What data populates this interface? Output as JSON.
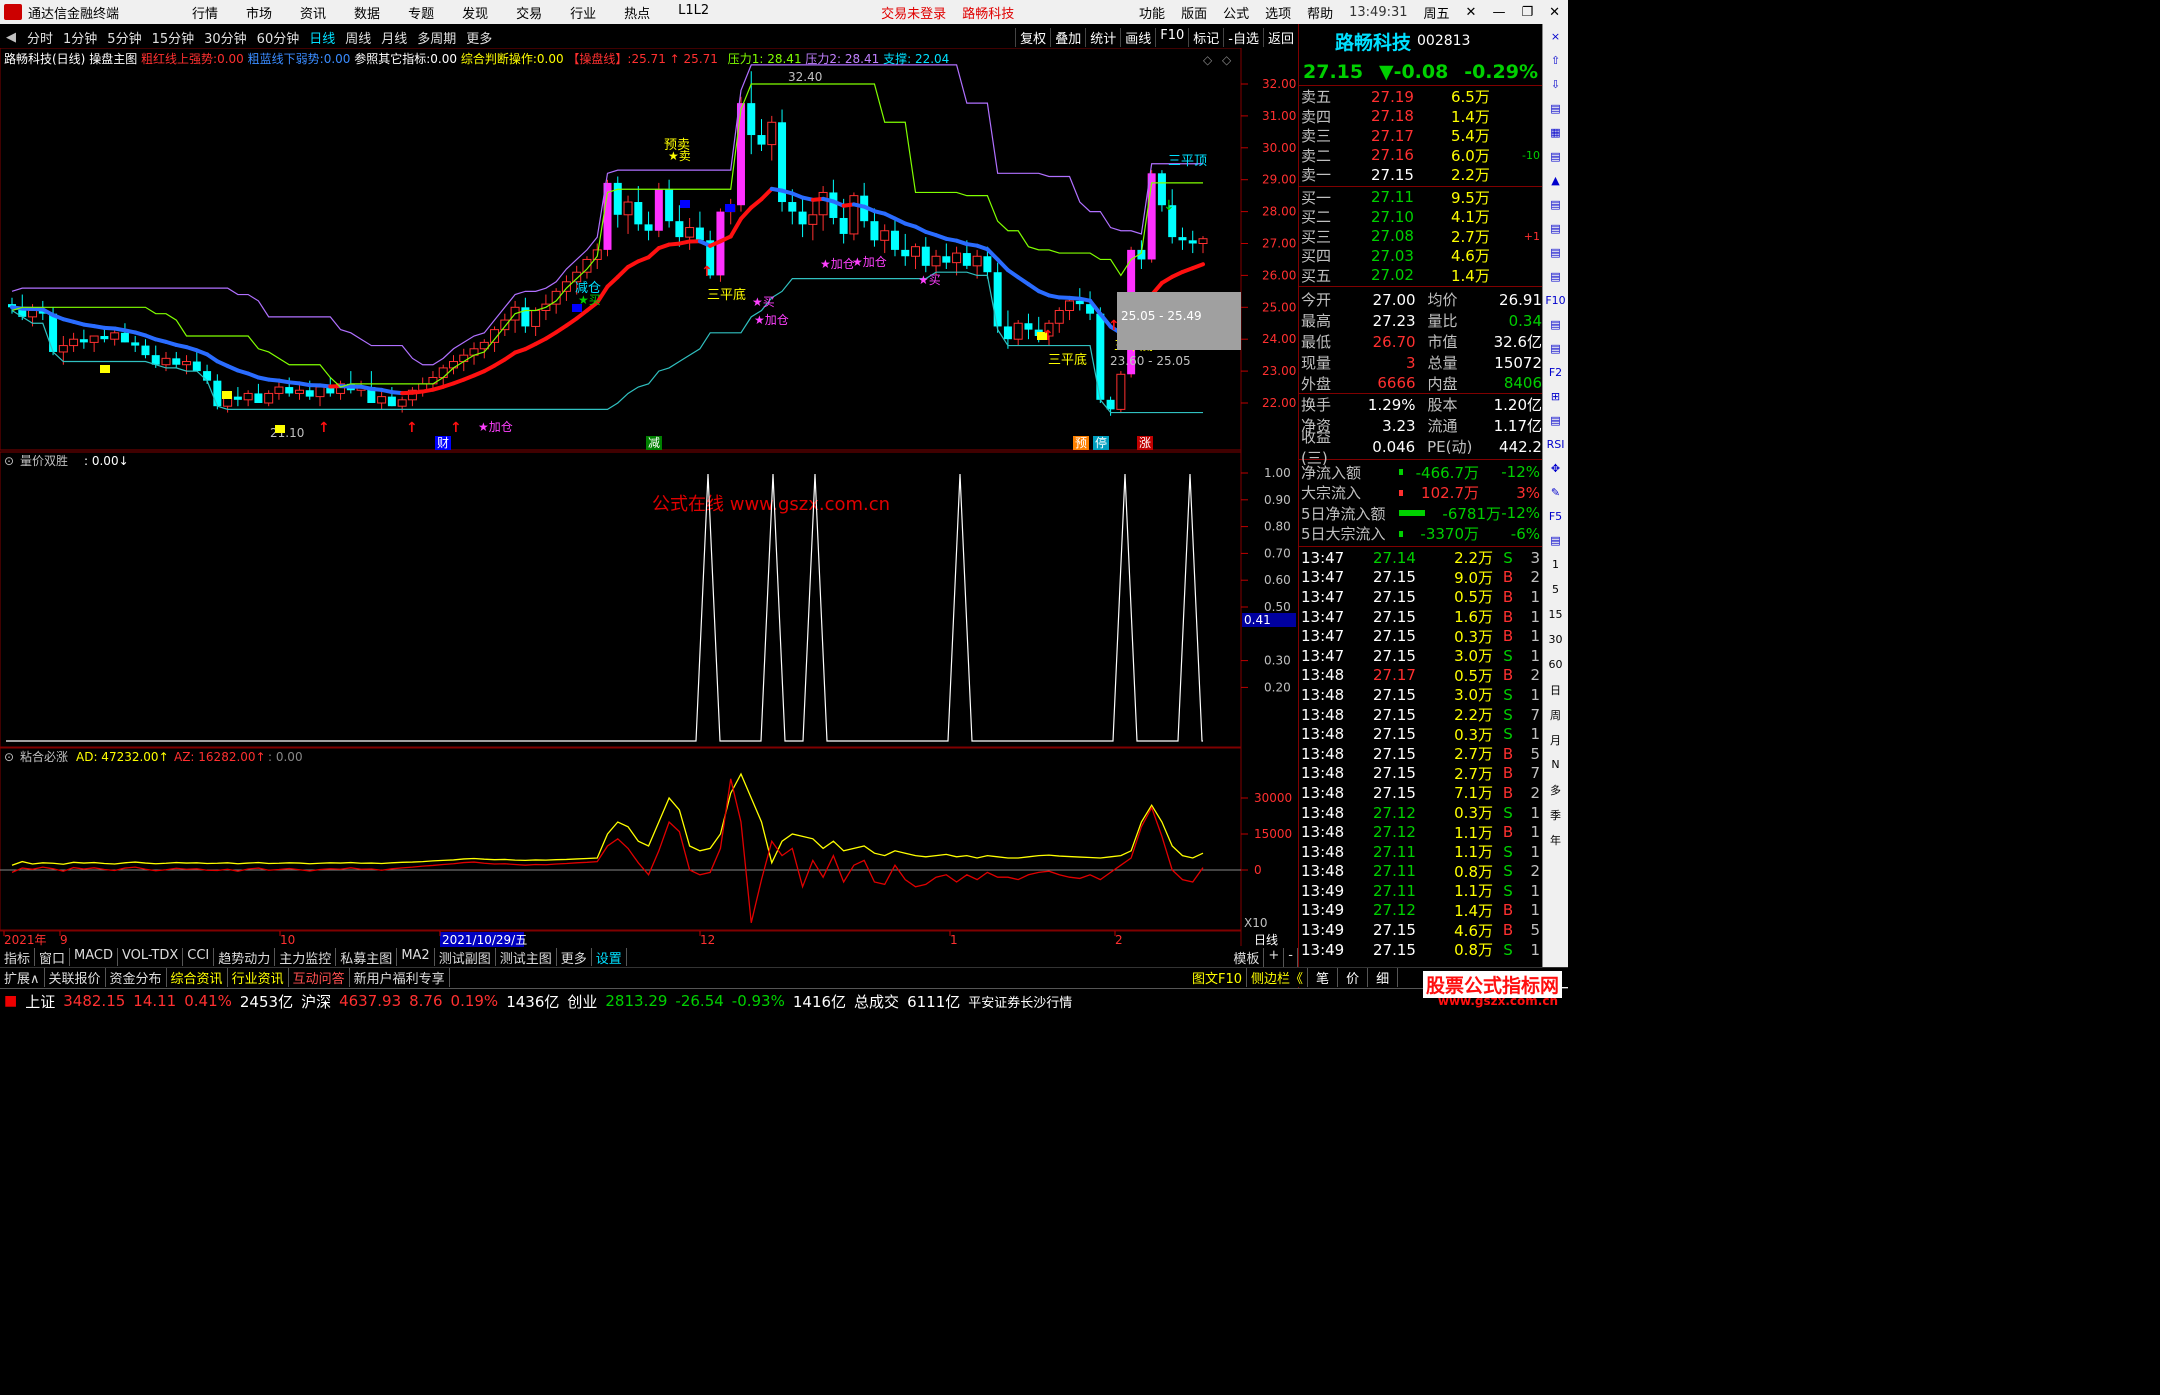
{
  "titlebar": {
    "app_title": "通达信金融终端",
    "menus": [
      "行情",
      "市场",
      "资讯",
      "数据",
      "专题",
      "发现",
      "交易",
      "行业",
      "热点",
      "L1L2"
    ],
    "login": "交易未登录",
    "stock": "路畅科技",
    "right_menus": [
      "功能",
      "版面",
      "公式",
      "选项",
      "帮助"
    ],
    "time": "13:49:31",
    "weekday": "周五"
  },
  "periods": [
    "分时",
    "1分钟",
    "5分钟",
    "15分钟",
    "30分钟",
    "60分钟",
    "日线",
    "周线",
    "月线",
    "多周期",
    "更多"
  ],
  "active_period": "日线",
  "toolbar": [
    "复权",
    "叠加",
    "统计",
    "画线",
    "F10",
    "标记",
    "-自选",
    "返回"
  ],
  "info": {
    "name": "路畅科技(日线)",
    "main": "操盘主图",
    "red_label": "粗红线上强势:",
    "red_val": "0.00",
    "blue_label": "粗蓝线下弱势:",
    "blue_val": "0.00",
    "ref_label": "参照其它指标:",
    "ref_val": "0.00",
    "judge_label": "综合判断操作:",
    "judge_val": "0.00",
    "op_label": "【操盘线】:",
    "op_val1": "25.71",
    "op_val2": "25.71",
    "p1": "压力1: 28.41",
    "p2": "压力2: 28.41",
    "sup": "支撑: 22.04"
  },
  "main_axis": [
    "32.00",
    "31.00",
    "30.00",
    "29.00",
    "28.00",
    "27.00",
    "26.00",
    "25.00",
    "24.00",
    "23.00",
    "22.00"
  ],
  "main_annotations": {
    "high": "32.40",
    "low": "21.10",
    "sell_ann": "预卖",
    "reduce": "减仓",
    "three_low": "三平底",
    "three_top": "三平顶",
    "add": "加仓",
    "buy": "买",
    "zone1": "25.05 - 25.49",
    "zone2": "23.60 - 25.05",
    "tags": [
      "财",
      "减",
      "预",
      "停",
      "涨"
    ]
  },
  "sub1": {
    "label": "量价双胜",
    "value": "0.00",
    "axis": [
      "1.00",
      "0.90",
      "0.80",
      "0.70",
      "0.60",
      "0.50",
      "0.30",
      "0.20"
    ],
    "cursor": "0.41",
    "watermark": "公式在线 www.gszx.com.cn"
  },
  "sub2": {
    "label": "粘合必涨",
    "ad_label": "AD: 47232.00",
    "az_label": "AZ: 16282.00",
    "extra": ": 0.00",
    "axis": [
      "30000",
      "15000",
      "0"
    ],
    "x10": "X10"
  },
  "xaxis": {
    "labels": [
      "2021年",
      "9",
      "10",
      "2021/10/29/五",
      "12",
      "1",
      "2"
    ],
    "unit": "日线"
  },
  "bottomtabs": [
    "指标",
    "窗口",
    "MACD",
    "VOL-TDX",
    "CCI",
    "趋势动力",
    "主力监控",
    "私募主图",
    "MA2",
    "测试副图",
    "测试主图",
    "更多",
    "设置"
  ],
  "bottomtabs_right": [
    "模板",
    "+",
    "-"
  ],
  "bottomtabs2": [
    "扩展∧",
    "关联报价",
    "资金分布",
    "综合资讯",
    "行业资讯",
    "互动问答",
    "新用户福利专享"
  ],
  "bottomtabs2_right": [
    "图文F10",
    "侧边栏《",
    "笔",
    "价",
    "细"
  ],
  "stock": {
    "name": "路畅科技",
    "code": "002813",
    "price": "27.15",
    "change": "▼-0.08",
    "pct": "-0.29%"
  },
  "asks": [
    {
      "l": "卖五",
      "p": "27.19",
      "v": "6.5万",
      "d": ""
    },
    {
      "l": "卖四",
      "p": "27.18",
      "v": "1.4万",
      "d": ""
    },
    {
      "l": "卖三",
      "p": "27.17",
      "v": "5.4万",
      "d": ""
    },
    {
      "l": "卖二",
      "p": "27.16",
      "v": "6.0万",
      "d": "-10"
    },
    {
      "l": "卖一",
      "p": "27.15",
      "v": "2.2万",
      "d": ""
    }
  ],
  "bids": [
    {
      "l": "买一",
      "p": "27.11",
      "v": "9.5万",
      "d": ""
    },
    {
      "l": "买二",
      "p": "27.10",
      "v": "4.1万",
      "d": ""
    },
    {
      "l": "买三",
      "p": "27.08",
      "v": "2.7万",
      "d": "+1"
    },
    {
      "l": "买四",
      "p": "27.03",
      "v": "4.6万",
      "d": ""
    },
    {
      "l": "买五",
      "p": "27.02",
      "v": "1.4万",
      "d": ""
    }
  ],
  "stats": [
    [
      [
        "今开",
        "27.00"
      ],
      [
        "均价",
        "26.91"
      ]
    ],
    [
      [
        "最高",
        "27.23"
      ],
      [
        "量比",
        "0.34"
      ]
    ],
    [
      [
        "最低",
        "26.70"
      ],
      [
        "市值",
        "32.6亿"
      ]
    ],
    [
      [
        "现量",
        "3"
      ],
      [
        "总量",
        "15072"
      ]
    ],
    [
      [
        "外盘",
        "6666"
      ],
      [
        "内盘",
        "8406"
      ]
    ],
    [
      [
        "换手",
        "1.29%"
      ],
      [
        "股本",
        "1.20亿"
      ]
    ],
    [
      [
        "净资",
        "3.23"
      ],
      [
        "流通",
        "1.17亿"
      ]
    ],
    [
      [
        "收益(三)",
        "0.046"
      ],
      [
        "PE(动)",
        "442.2"
      ]
    ]
  ],
  "flows": [
    {
      "l": "净流入额",
      "v": "-466.7万",
      "p": "-12%"
    },
    {
      "l": "大宗流入",
      "v": "102.7万",
      "p": "3%"
    },
    {
      "l": "5日净流入额",
      "v": "-6781万",
      "p": "-12%"
    },
    {
      "l": "5日大宗流入",
      "v": "-3370万",
      "p": "-6%"
    }
  ],
  "ticks": [
    [
      "13:47",
      "27.14",
      "2.2万",
      "S",
      "3"
    ],
    [
      "13:47",
      "27.15",
      "9.0万",
      "B",
      "2"
    ],
    [
      "13:47",
      "27.15",
      "0.5万",
      "B",
      "1"
    ],
    [
      "13:47",
      "27.15",
      "1.6万",
      "B",
      "1"
    ],
    [
      "13:47",
      "27.15",
      "0.3万",
      "B",
      "1"
    ],
    [
      "13:47",
      "27.15",
      "3.0万",
      "S",
      "1"
    ],
    [
      "13:48",
      "27.17",
      "0.5万",
      "B",
      "2"
    ],
    [
      "13:48",
      "27.15",
      "3.0万",
      "S",
      "1"
    ],
    [
      "13:48",
      "27.15",
      "2.2万",
      "S",
      "7"
    ],
    [
      "13:48",
      "27.15",
      "0.3万",
      "S",
      "1"
    ],
    [
      "13:48",
      "27.15",
      "2.7万",
      "B",
      "5"
    ],
    [
      "13:48",
      "27.15",
      "2.7万",
      "B",
      "7"
    ],
    [
      "13:48",
      "27.15",
      "7.1万",
      "B",
      "2"
    ],
    [
      "13:48",
      "27.12",
      "0.3万",
      "S",
      "1"
    ],
    [
      "13:48",
      "27.12",
      "1.1万",
      "B",
      "1"
    ],
    [
      "13:48",
      "27.11",
      "1.1万",
      "S",
      "1"
    ],
    [
      "13:48",
      "27.11",
      "0.8万",
      "S",
      "2"
    ],
    [
      "13:49",
      "27.11",
      "1.1万",
      "S",
      "1"
    ],
    [
      "13:49",
      "27.12",
      "1.4万",
      "B",
      "1"
    ],
    [
      "13:49",
      "27.15",
      "4.6万",
      "B",
      "5"
    ],
    [
      "13:49",
      "27.15",
      "0.8万",
      "S",
      "1"
    ]
  ],
  "rightbar": [
    "1",
    "5",
    "15",
    "30",
    "60",
    "日",
    "周",
    "月",
    "N",
    "多",
    "季",
    "年"
  ],
  "status": {
    "sh_label": "上证",
    "sh": "3482.15",
    "sh_c": "14.11",
    "sh_p": "0.41%",
    "sh_amt": "2453亿",
    "sz_label": "沪深",
    "sz": "4637.93",
    "sz_c": "8.76",
    "sz_p": "0.19%",
    "sz_amt": "1436亿",
    "cy_label": "创业",
    "cy": "2813.29",
    "cy_c": "-26.54",
    "cy_p": "-0.93%",
    "cy_amt": "1416亿",
    "tot_label": "总成交",
    "tot": "6111亿",
    "broker": "平安证券长沙行情",
    "watermark": "股票公式指标网",
    "watermark2": "www.gszx.com.cn"
  }
}
